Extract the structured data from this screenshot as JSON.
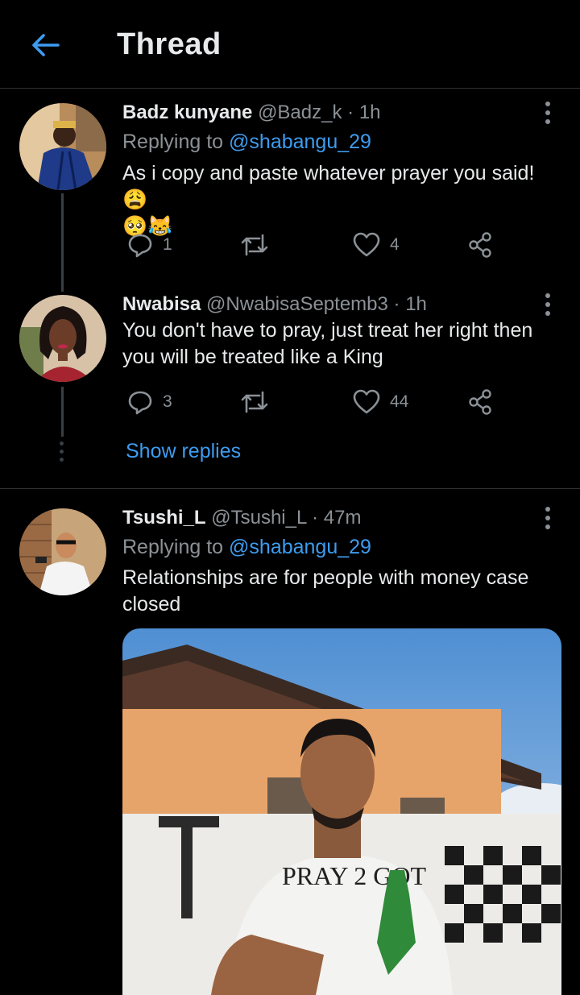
{
  "header": {
    "title": "Thread",
    "back_icon": "arrow-left-icon"
  },
  "tweets": [
    {
      "name": "Badz kunyane",
      "handle": "@Badz_k",
      "time": "· 1h",
      "replying_label": "Replying to",
      "replying_to": "@shabangu_29",
      "text": "As i copy and paste whatever prayer you said!😩",
      "emoji_line": "🥺😹",
      "replies": "1",
      "retweets": "",
      "likes": "4"
    },
    {
      "name": "Nwabisa",
      "handle": "@NwabisaSeptemb3",
      "time": "· 1h",
      "text_line1": "You don't have to pray, just treat her right then",
      "text_line2": "you will be treated like a King",
      "replies": "3",
      "retweets": "",
      "likes": "44"
    },
    {
      "name": "Tsushi_L",
      "handle": "@Tsushi_L",
      "time": "· 47m",
      "replying_label": "Replying to",
      "replying_to": "@shabangu_29",
      "text_line1": "Relationships are for people with money case",
      "text_line2": "closed",
      "image_text": "PRAY 2 GOT"
    }
  ],
  "show_replies": "Show replies",
  "colors": {
    "accent": "#3d9cf0",
    "background": "#000000",
    "muted": "#8b9196"
  }
}
